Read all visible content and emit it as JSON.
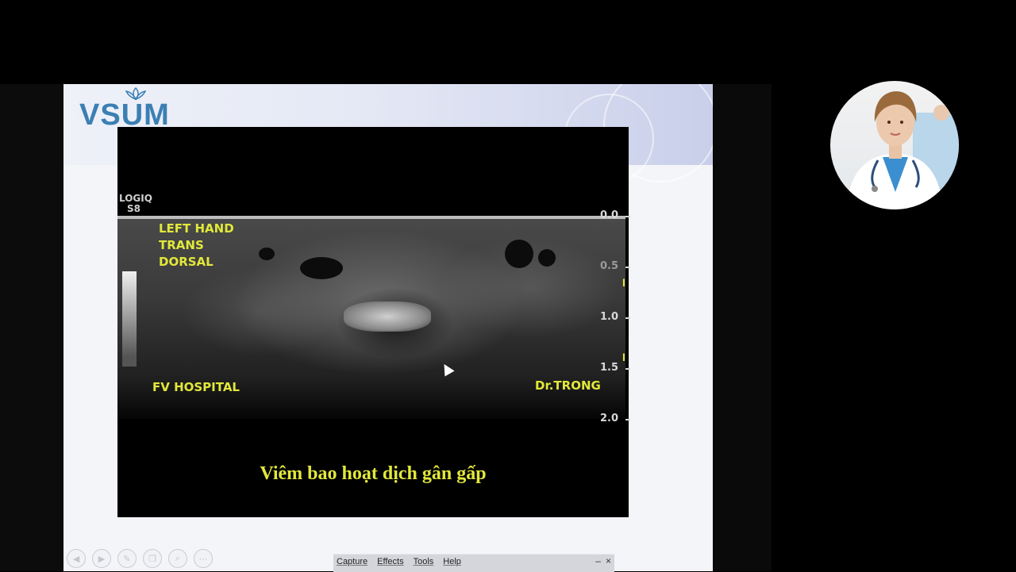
{
  "slide": {
    "logo_text": "VSUM",
    "ultrasound": {
      "machine_line1": "LOGIQ",
      "machine_line2": "S8",
      "labels": [
        "LEFT HAND",
        "TRANS",
        "DORSAL"
      ],
      "hospital": "FV HOSPITAL",
      "doctor": "Dr.TRONG",
      "depth_scale": [
        "0.0",
        "0.5",
        "1.0",
        "1.5",
        "2.0"
      ],
      "caption": "Viêm bao hoạt dịch gân gấp"
    }
  },
  "recorder_toolbar": {
    "menu": [
      "Capture",
      "Effects",
      "Tools",
      "Help"
    ],
    "minimize": "–",
    "close": "×"
  },
  "colors": {
    "annotation_yellow": "#e2e83a",
    "logo_blue": "#3b7fb3"
  },
  "icons": [
    "lotus-logo-icon",
    "nav-prev-icon",
    "nav-next-icon",
    "pen-icon",
    "copy-icon",
    "zoom-icon",
    "menu-dots-icon"
  ]
}
